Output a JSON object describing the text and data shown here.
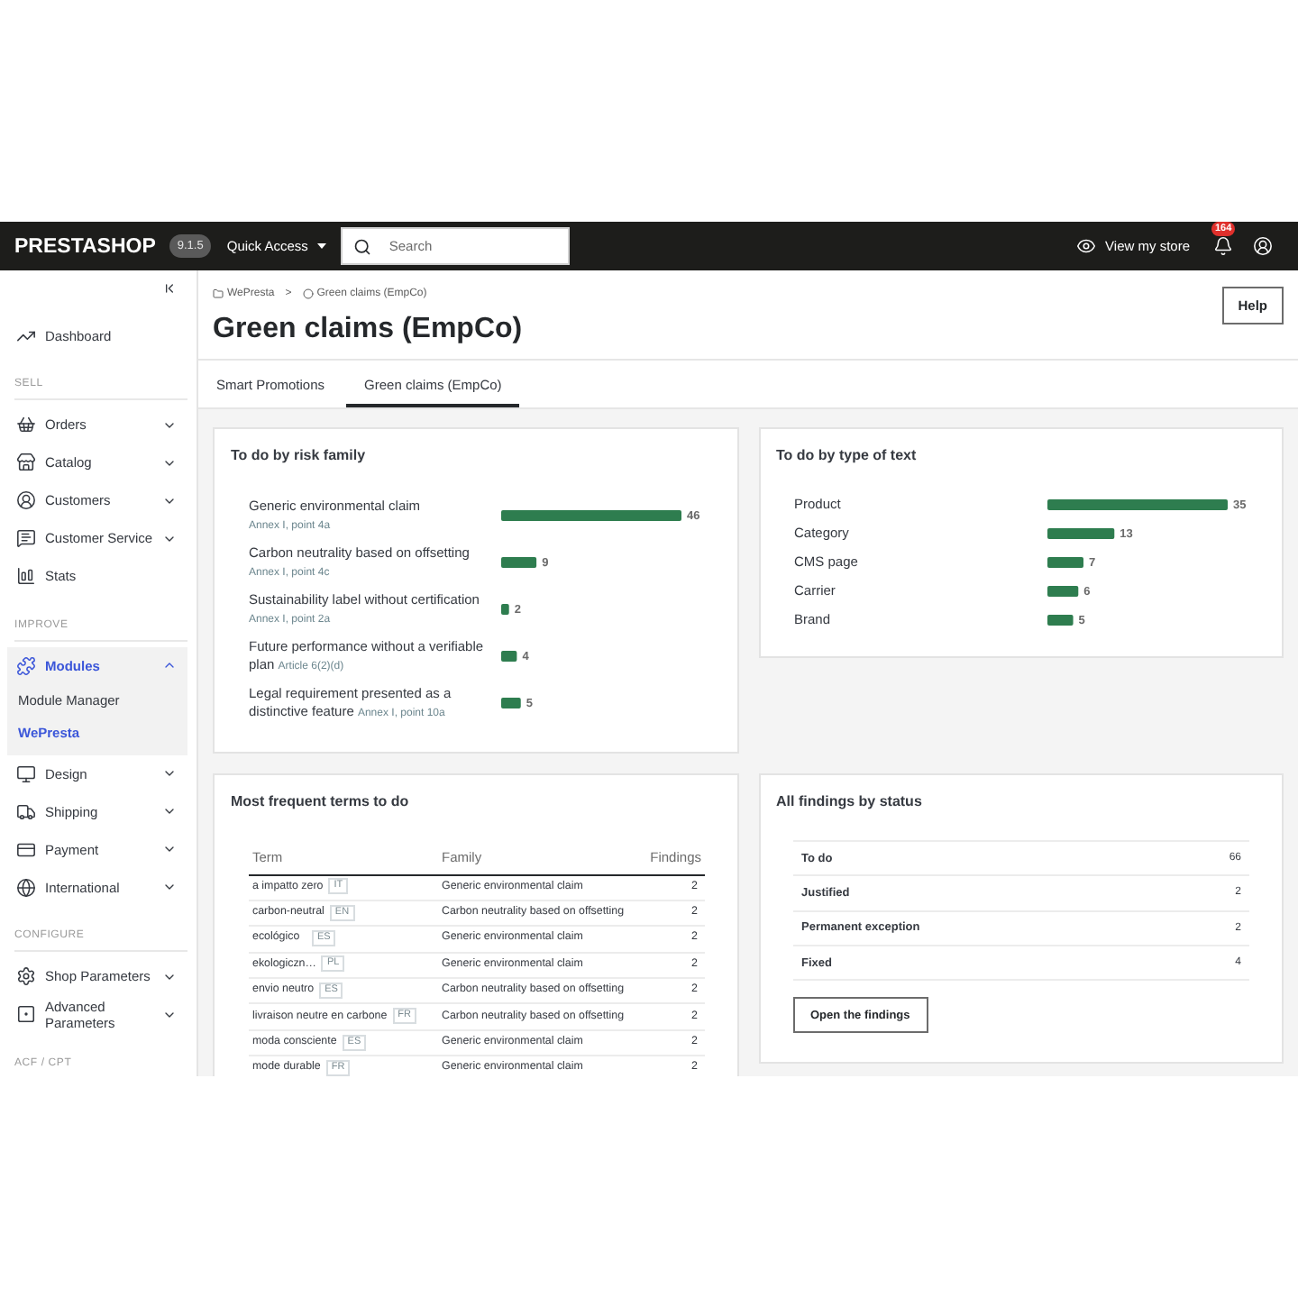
{
  "header": {
    "logo": "PRESTASHOP",
    "version": "9.1.5",
    "quick_access": "Quick Access",
    "search": {
      "placeholder": "Search"
    },
    "view_store": "View my store",
    "notifications": "164"
  },
  "sidebar": {
    "sections": [
      {
        "items": [
          {
            "label": "Dashboard",
            "selected": false
          }
        ]
      },
      {
        "title": "SELL",
        "items": [
          {
            "label": "Orders",
            "selected": false,
            "expanded": false
          },
          {
            "label": "Catalog",
            "selected": false,
            "expanded": false
          },
          {
            "label": "Customers",
            "selected": false,
            "expanded": false
          },
          {
            "label": "Customer Service",
            "selected": false,
            "expanded": false
          },
          {
            "label": "Stats",
            "selected": false
          }
        ]
      },
      {
        "title": "IMPROVE",
        "items": [
          {
            "label": "Modules",
            "selected": true,
            "expanded": true,
            "children": [
              {
                "label": "Module Manager",
                "selected": false
              },
              {
                "label": "WePresta",
                "selected": true
              }
            ]
          },
          {
            "label": "Design",
            "selected": false,
            "expanded": false
          },
          {
            "label": "Shipping",
            "selected": false,
            "expanded": false
          },
          {
            "label": "Payment",
            "selected": false,
            "expanded": false
          },
          {
            "label": "International",
            "selected": false,
            "expanded": false
          }
        ]
      },
      {
        "title": "CONFIGURE",
        "items": [
          {
            "label": "Shop Parameters",
            "selected": false,
            "expanded": false
          },
          {
            "label": "Advanced Parameters",
            "selected": false,
            "expanded": false
          }
        ]
      },
      {
        "title": "ACF / CPT"
      }
    ]
  },
  "breadcrumb": {
    "items": [
      "WePresta",
      "Green claims (EmpCo)"
    ],
    "separator": ">"
  },
  "title": "Green claims (EmpCo)",
  "help_button": "Help",
  "tabs": [
    {
      "label": "Smart Promotions",
      "selected": false
    },
    {
      "label": "Green claims (EmpCo)",
      "selected": true
    }
  ],
  "risk_family": {
    "title": "To do by risk family",
    "references": [
      "Annex I, point 4a",
      "Annex I, point 4c",
      "Annex I, point 2a",
      "Article 6(2)(d)",
      "Annex I, point 10a"
    ],
    "chart_data": {
      "type": "bar",
      "orientation": "horizontal",
      "categories": [
        "Generic environmental claim",
        "Carbon neutrality based on offsetting",
        "Sustainability label without certification",
        "Future performance without a verifiable plan",
        "Legal requirement presented as a distinctive feature"
      ],
      "values": [
        46,
        9,
        2,
        4,
        5
      ],
      "data_labels": true
    }
  },
  "text_types": {
    "title": "To do by type of text",
    "chart_data": {
      "type": "bar",
      "orientation": "horizontal",
      "categories": [
        "Product",
        "Category",
        "CMS page",
        "Carrier",
        "Brand"
      ],
      "values": [
        35,
        13,
        7,
        6,
        5
      ],
      "data_labels": true
    }
  },
  "frequent_terms": {
    "title": "Most frequent terms to do",
    "columns": [
      "Term",
      "Family",
      "Findings"
    ],
    "rows": [
      {
        "term": "a impatto zero",
        "language": "IT",
        "family": "Generic environmental claim",
        "findings": "2"
      },
      {
        "term": "carbon-neutral",
        "language": "EN",
        "family": "Carbon neutrality based on offsetting",
        "findings": "2"
      },
      {
        "term": "ecológico",
        "language": "ES",
        "family": "Generic environmental claim",
        "findings": "2"
      },
      {
        "term": "ekologiczn…",
        "language": "PL",
        "family": "Generic environmental claim",
        "findings": "2"
      },
      {
        "term": "envio neutro",
        "language": "ES",
        "family": "Carbon neutrality based on offsetting",
        "findings": "2"
      },
      {
        "term": "livraison neutre en carbone",
        "language": "FR",
        "family": "Carbon neutrality based on offsetting",
        "findings": "2"
      },
      {
        "term": "moda consciente",
        "language": "ES",
        "family": "Generic environmental claim",
        "findings": "2"
      },
      {
        "term": "mode durable",
        "language": "FR",
        "family": "Generic environmental claim",
        "findings": "2"
      }
    ]
  },
  "status": {
    "title": "All findings by status",
    "rows": [
      {
        "label": "To do",
        "count": "66"
      },
      {
        "label": "Justified",
        "count": "2"
      },
      {
        "label": "Permanent exception",
        "count": "2"
      },
      {
        "label": "Fixed",
        "count": "4"
      }
    ],
    "button": "Open the findings"
  }
}
